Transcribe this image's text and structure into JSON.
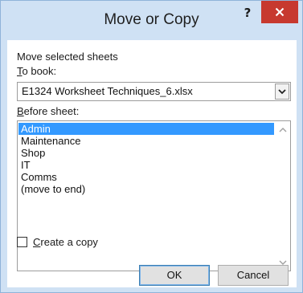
{
  "window": {
    "title": "Move or Copy",
    "help_label": "?",
    "colors": {
      "title_bar": "#cfe1f4",
      "close_button": "#c7392f",
      "selection": "#3399ff"
    }
  },
  "form": {
    "section_label": "Move selected sheets",
    "to_book": {
      "mnemonic": "T",
      "label_rest": "o book:",
      "value": "E1324 Worksheet Techniques_6.xlsx"
    },
    "before_sheet": {
      "mnemonic": "B",
      "label_rest": "efore sheet:",
      "items": [
        {
          "label": "Admin",
          "selected": true
        },
        {
          "label": "Maintenance",
          "selected": false
        },
        {
          "label": "Shop",
          "selected": false
        },
        {
          "label": "IT",
          "selected": false
        },
        {
          "label": "Comms",
          "selected": false
        },
        {
          "label": "(move to end)",
          "selected": false
        }
      ]
    },
    "create_copy": {
      "mnemonic": "C",
      "label_rest": "reate a copy",
      "checked": false
    }
  },
  "buttons": {
    "ok_label": "OK",
    "cancel_label": "Cancel"
  },
  "icons": {
    "close": "close-icon",
    "dropdown": "chevron-down-icon",
    "scroll_up": "chevron-up-icon",
    "scroll_down": "chevron-down-icon"
  }
}
